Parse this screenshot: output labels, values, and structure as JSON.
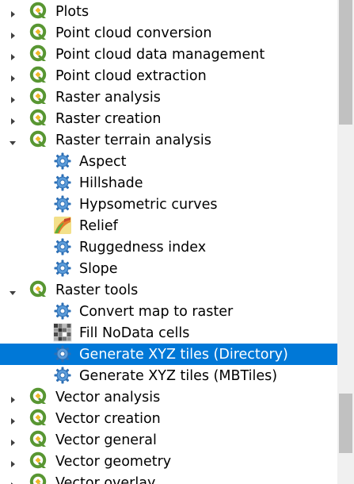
{
  "tree": {
    "rows": [
      {
        "label": "Plots",
        "type": "group",
        "expanded": false
      },
      {
        "label": "Point cloud conversion",
        "type": "group",
        "expanded": false
      },
      {
        "label": "Point cloud data management",
        "type": "group",
        "expanded": false
      },
      {
        "label": "Point cloud extraction",
        "type": "group",
        "expanded": false
      },
      {
        "label": "Raster analysis",
        "type": "group",
        "expanded": false
      },
      {
        "label": "Raster creation",
        "type": "group",
        "expanded": false
      },
      {
        "label": "Raster terrain analysis",
        "type": "group",
        "expanded": true
      },
      {
        "label": "Aspect",
        "type": "tool",
        "icon": "gear-icon"
      },
      {
        "label": "Hillshade",
        "type": "tool",
        "icon": "gear-icon"
      },
      {
        "label": "Hypsometric curves",
        "type": "tool",
        "icon": "gear-icon"
      },
      {
        "label": "Relief",
        "type": "tool",
        "icon": "relief-icon"
      },
      {
        "label": "Ruggedness index",
        "type": "tool",
        "icon": "gear-icon"
      },
      {
        "label": "Slope",
        "type": "tool",
        "icon": "gear-icon"
      },
      {
        "label": "Raster tools",
        "type": "group",
        "expanded": true
      },
      {
        "label": "Convert map to raster",
        "type": "tool",
        "icon": "gear-icon"
      },
      {
        "label": "Fill NoData cells",
        "type": "tool",
        "icon": "grid-icon"
      },
      {
        "label": "Generate XYZ tiles (Directory)",
        "type": "tool",
        "icon": "gear-icon",
        "selected": true
      },
      {
        "label": "Generate XYZ tiles (MBTiles)",
        "type": "tool",
        "icon": "gear-icon"
      },
      {
        "label": "Vector analysis",
        "type": "group",
        "expanded": false
      },
      {
        "label": "Vector creation",
        "type": "group",
        "expanded": false
      },
      {
        "label": "Vector general",
        "type": "group",
        "expanded": false
      },
      {
        "label": "Vector geometry",
        "type": "group",
        "expanded": false
      },
      {
        "label": "Vector overlay",
        "type": "group",
        "expanded": false
      }
    ]
  },
  "colors": {
    "selection": "#0078d7",
    "qgis_green": "#589632",
    "qgis_yellow": "#eeb728",
    "gear_blue": "#3c7fc4"
  }
}
